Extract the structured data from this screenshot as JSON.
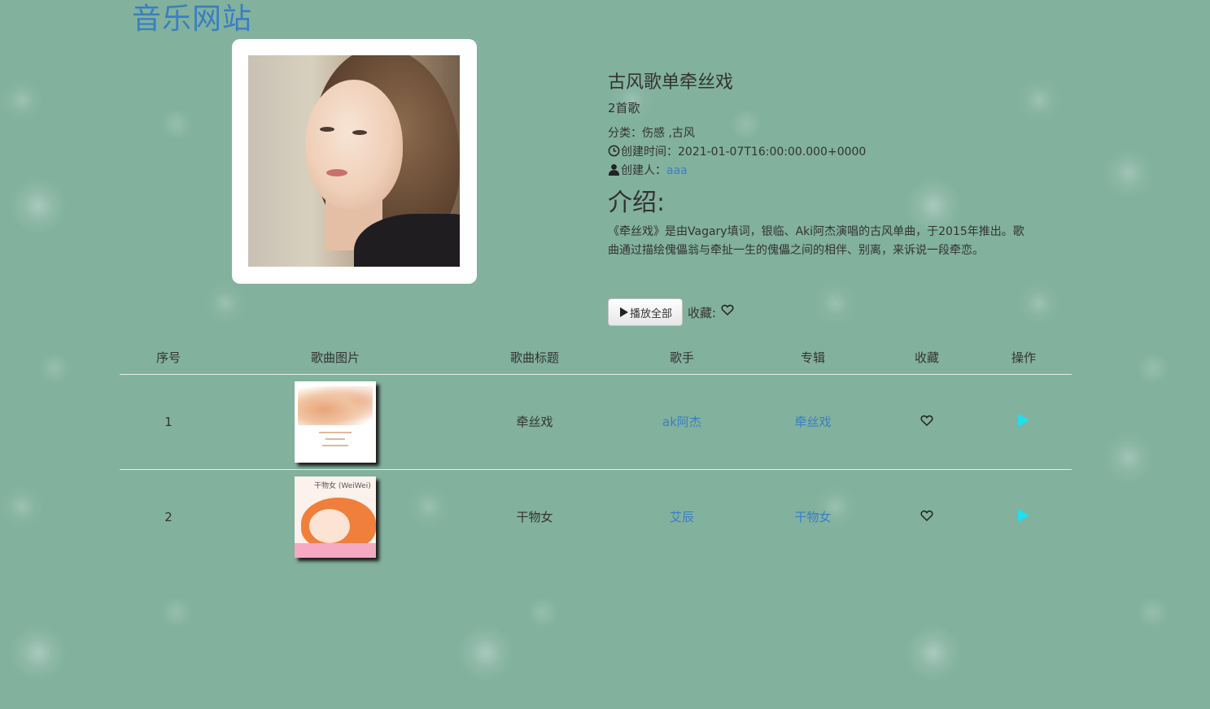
{
  "site": {
    "title": "音乐网站"
  },
  "playlist": {
    "title": "古风歌单牵丝戏",
    "song_count": "2首歌",
    "category_label": "分类：",
    "category_value": "伤感 ,古风",
    "created_label": "创建时间：",
    "created_value": "2021-01-07T16:00:00.000+0000",
    "creator_label": "创建人：",
    "creator_value": "aaa",
    "intro_heading": "介绍:",
    "intro_text": "《牵丝戏》是由Vagary填词，银临、Aki阿杰演唱的古风单曲，于2015年推出。歌曲通过描绘傀儡翁与牵扯一生的傀儡之间的相伴、别离，来诉说一段牵恋。"
  },
  "actions": {
    "play_all_label": "播放全部",
    "favorite_label": "收藏:"
  },
  "table": {
    "headers": [
      "序号",
      "歌曲图片",
      "歌曲标题",
      "歌手",
      "专辑",
      "收藏",
      "操作"
    ],
    "rows": [
      {
        "index": "1",
        "title": "牵丝戏",
        "singer": "ak阿杰",
        "album": "牵丝戏"
      },
      {
        "index": "2",
        "title": "干物女",
        "singer": "艾辰",
        "album": "干物女",
        "cover_text": "干物女 (WeiWei)"
      }
    ]
  },
  "colors": {
    "background": "#82b19e",
    "link": "#3a7fc0",
    "play_icon": "#1ee0ee"
  },
  "icons": {
    "clock": "clock-icon",
    "user": "user-icon",
    "heart": "heart-outline-icon",
    "play": "play-icon"
  }
}
